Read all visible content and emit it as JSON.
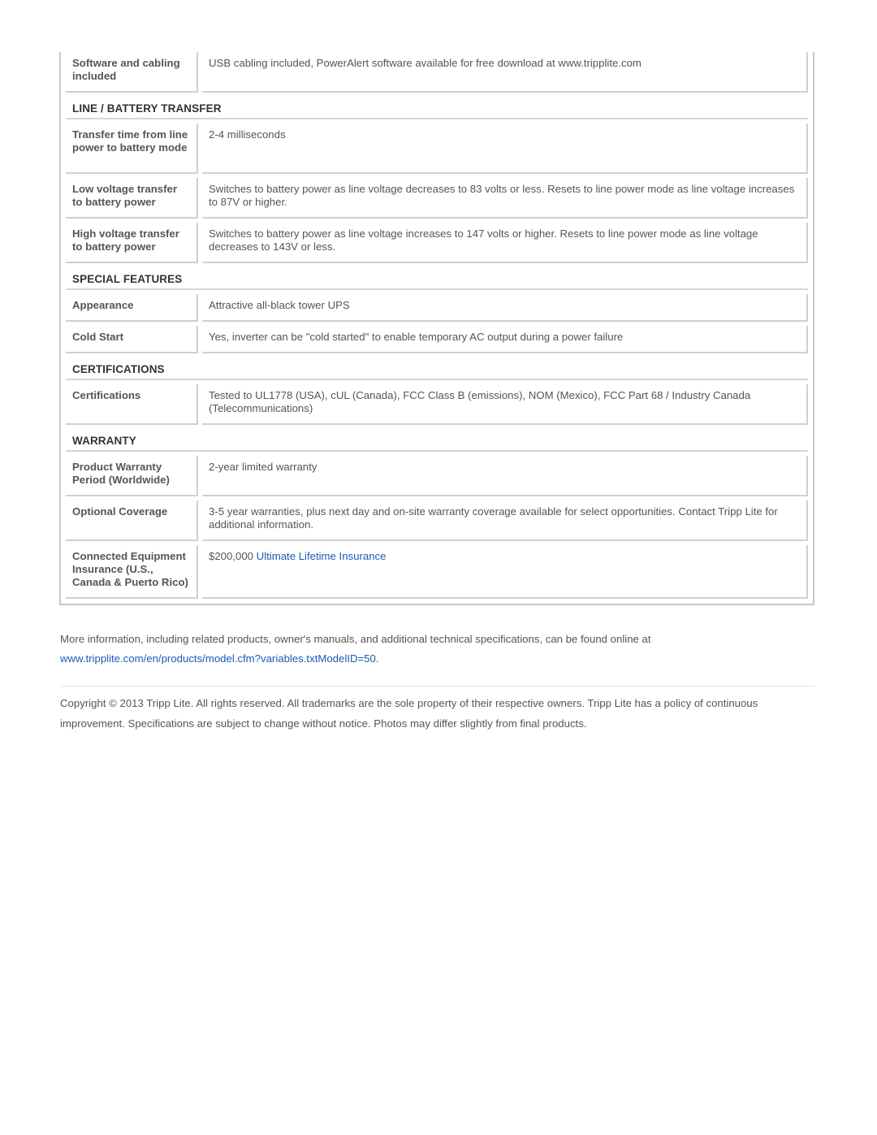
{
  "spec_table": {
    "top_rows": [
      {
        "label": "Software and cabling included",
        "value": "USB cabling included, PowerAlert software available for free download at www.tripplite.com"
      }
    ],
    "sections": [
      {
        "title": "LINE / BATTERY TRANSFER",
        "rows": [
          {
            "label": "Transfer time from line power to battery mode",
            "value": "2-4 milliseconds"
          },
          {
            "label": "Low voltage transfer to battery power",
            "value": "Switches to battery power as line voltage decreases to 83 volts or less. Resets to line power mode as line voltage increases to 87V or higher."
          },
          {
            "label": "High voltage transfer to battery power",
            "value": "Switches to battery power as line voltage increases to 147 volts or higher. Resets to line power mode as line voltage decreases to 143V or less."
          }
        ]
      },
      {
        "title": "SPECIAL FEATURES",
        "rows": [
          {
            "label": "Appearance",
            "value": "Attractive all-black tower UPS"
          },
          {
            "label": "Cold Start",
            "value": "Yes, inverter can be \"cold started\" to enable temporary AC output during a power failure"
          }
        ]
      },
      {
        "title": "CERTIFICATIONS",
        "rows": [
          {
            "label": "Certifications",
            "value": "Tested to UL1778 (USA), cUL (Canada), FCC Class B (emissions), NOM (Mexico), FCC Part 68 / Industry Canada (Telecommunications)"
          }
        ]
      },
      {
        "title": "WARRANTY",
        "rows": [
          {
            "label": "Product Warranty Period (Worldwide)",
            "value": "2-year limited warranty"
          },
          {
            "label": "Optional Coverage",
            "value": "3-5 year warranties, plus next day and on-site warranty coverage available for select opportunities. Contact Tripp Lite for additional information."
          },
          {
            "label": "Connected Equipment Insurance (U.S., Canada & Puerto Rico)",
            "value_prefix": "$200,000 ",
            "value_link": "Ultimate Lifetime Insurance"
          }
        ]
      }
    ]
  },
  "footer": {
    "more_info_text": "More information, including related products, owner's manuals, and additional technical specifications, can be found online at",
    "more_info_link": "www.tripplite.com/en/products/model.cfm?variables.txtModelID=50",
    "more_info_suffix": ".",
    "copyright_line1": "Copyright © 2013 Tripp Lite. All rights reserved. All trademarks are the sole property of their respective owners. Tripp Lite has a policy of continuous",
    "copyright_line2": "improvement. Specifications are subject to change without notice. Photos may differ slightly from final products."
  },
  "colors": {
    "text": "#555555",
    "heading": "#333333",
    "link": "#1a5bb8",
    "border": "#d0d0d0"
  }
}
